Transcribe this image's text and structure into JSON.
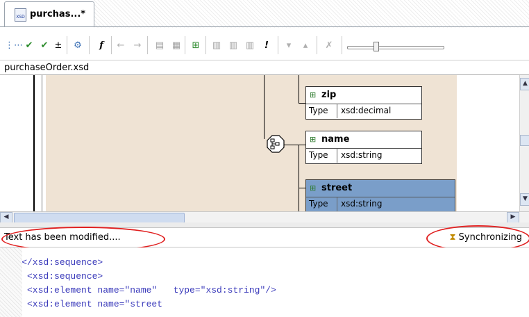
{
  "tab": {
    "label": "purchas...*",
    "icon": "xsd-file-icon"
  },
  "toolbar": {
    "icons": [
      "expand-tree-icon",
      "validate-icon",
      "validate-all-icon",
      "download-icon",
      "settings-icon",
      "function-icon",
      "back-icon",
      "forward-icon",
      "copy-icon",
      "paste-icon",
      "generate-icon",
      "layout-icon",
      "layout-alt-icon",
      "layout-third-icon",
      "warning-icon",
      "down-arrow-icon",
      "up-arrow-icon",
      "delete-icon",
      "zoom-slider"
    ]
  },
  "file_label": "purchaseOrder.xsd",
  "diagram": {
    "nodes": [
      {
        "name": "zip",
        "type_label": "Type",
        "type_value": "xsd:decimal",
        "selected": false
      },
      {
        "name": "name",
        "type_label": "Type",
        "type_value": "xsd:string",
        "selected": false
      },
      {
        "name": "street",
        "type_label": "Type",
        "type_value": "xsd:string",
        "selected": true
      }
    ],
    "colors": {
      "canvas": "#efe3d4",
      "selected": "#7a9ec9"
    }
  },
  "status": {
    "message": "Text has been modified....",
    "sync": "Synchronizing",
    "highlight_color": "#e02020"
  },
  "code": {
    "lines": [
      "    </xsd:sequence>",
      "     <xsd:sequence>",
      "     <xsd:element name=\"name\"   type=\"xsd:string\"/>",
      "     <xsd:element name=\"street"
    ]
  }
}
